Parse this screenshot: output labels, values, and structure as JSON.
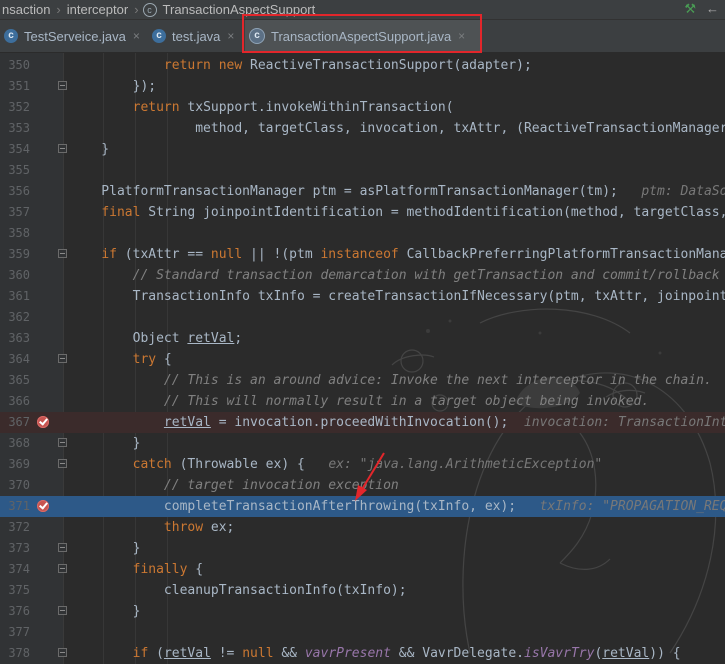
{
  "breadcrumb": {
    "items": [
      "nsaction",
      "interceptor",
      "TransactionAspectSupport"
    ]
  },
  "tabs": [
    {
      "label": "TestServeice.java",
      "icon": "class-icon"
    },
    {
      "label": "test.java",
      "icon": "class-icon"
    },
    {
      "label": "TransactionAspectSupport.java",
      "icon": "class-icon",
      "active": true
    }
  ],
  "close_glyph": "×",
  "editor": {
    "lines": [
      {
        "n": "350",
        "html": "            <span class='kw'>return new</span> ReactiveTransactionSupport(adapter);"
      },
      {
        "n": "351",
        "html": "        });"
      },
      {
        "n": "352",
        "html": "        <span class='kw'>return</span> txSupport.invokeWithinTransaction("
      },
      {
        "n": "353",
        "html": "                method, targetClass, invocation, txAttr, (ReactiveTransactionManager) tm);"
      },
      {
        "n": "354",
        "html": "    }"
      },
      {
        "n": "355",
        "html": ""
      },
      {
        "n": "356",
        "html": "    PlatformTransactionManager ptm = asPlatformTransactionManager(tm);   <span class='hint'>ptm: DataSourceTransactionManager</span>"
      },
      {
        "n": "357",
        "html": "    <span class='kw'>final</span> String joinpointIdentification = methodIdentification(method, targetClass, txAttr);"
      },
      {
        "n": "358",
        "html": ""
      },
      {
        "n": "359",
        "html": "    <span class='kw'>if</span> (txAttr == <span class='kw'>null</span> || !(ptm <span class='kw'>instanceof</span> CallbackPreferringPlatformTransactionManager)) {"
      },
      {
        "n": "360",
        "html": "        <span class='cmi'>// Standard transaction demarcation with getTransaction and commit/rollback calls.</span>"
      },
      {
        "n": "361",
        "html": "        TransactionInfo txInfo = createTransactionIfNecessary(ptm, txAttr, joinpointIdentification);"
      },
      {
        "n": "362",
        "html": ""
      },
      {
        "n": "363",
        "html": "        Object <span class='ul'>retVal</span>;"
      },
      {
        "n": "364",
        "html": "        <span class='kw'>try</span> {"
      },
      {
        "n": "365",
        "html": "            <span class='cmi'>// This is an around advice: Invoke the next interceptor in the chain.</span>"
      },
      {
        "n": "366",
        "html": "            <span class='cmi'>// This will normally result in a target object being invoked.</span>"
      },
      {
        "n": "367",
        "html": "            <span class='ul'>retVal</span> = invocation.proceedWithInvocation();  <span class='hint'>invocation: TransactionInterceptor</span>",
        "bp": true
      },
      {
        "n": "368",
        "html": "        }"
      },
      {
        "n": "369",
        "html": "        <span class='kw'>catch</span> (Throwable ex) {   <span class='hint'>ex: \"java.lang.ArithmeticException\"</span>"
      },
      {
        "n": "370",
        "html": "            <span class='cmi'>// target invocation exception</span>"
      },
      {
        "n": "371",
        "html": "            completeTransactionAfterThrowing(txInfo, ex);   <span class='hint'>txInfo: \"PROPAGATION_REQUIRED\"</span>",
        "bp": true,
        "current": true
      },
      {
        "n": "372",
        "html": "            <span class='kw'>throw</span> ex;"
      },
      {
        "n": "373",
        "html": "        }"
      },
      {
        "n": "374",
        "html": "        <span class='kw'>finally</span> {"
      },
      {
        "n": "375",
        "html": "            cleanupTransactionInfo(txInfo);"
      },
      {
        "n": "376",
        "html": "        }"
      },
      {
        "n": "377",
        "html": ""
      },
      {
        "n": "378",
        "html": "        <span class='kw'>if</span> (<span class='ul'>retVal</span> != <span class='kw'>null</span> &amp;&amp; <span class='it'>vavrPresent</span> &amp;&amp; VavrDelegate.<span class='it'>isVavrTry</span>(<span class='ul'>retVal</span>)) {"
      }
    ]
  },
  "folds": [
    "351",
    "354",
    "359",
    "364",
    "368",
    "369",
    "373",
    "374",
    "376",
    "378"
  ],
  "colors": {
    "highlight": "#e2262b",
    "current_line": "#2d5988",
    "breakpoint": "#c75450"
  }
}
